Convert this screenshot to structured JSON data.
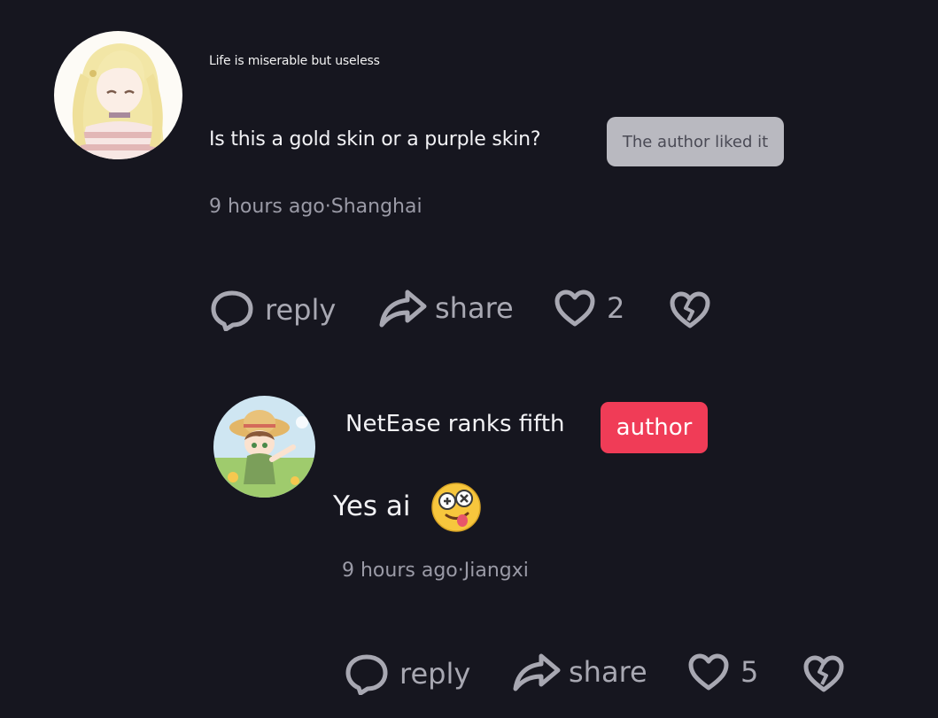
{
  "comment": {
    "username": "Life is miserable but useless",
    "text": "Is this a gold skin or a purple skin?",
    "liked_badge": "The author liked it",
    "time": "9 hours ago",
    "location": "Shanghai",
    "meta": "9 hours ago·Shanghai",
    "actions": {
      "reply": "reply",
      "share": "share",
      "likes": "2"
    },
    "icons": [
      "speech-bubble-icon",
      "share-arrow-icon",
      "heart-icon",
      "broken-heart-icon"
    ]
  },
  "reply": {
    "username": "NetEase ranks fifth",
    "badge": "author",
    "text": "Yes ai",
    "emoji": "dizzy-tongue-emoji",
    "meta": "9 hours ago·Jiangxi",
    "actions": {
      "reply": "reply",
      "share": "share",
      "likes": "5"
    }
  },
  "colors": {
    "background": "#16161f",
    "author_badge": "#f03c57",
    "liked_badge": "#b9b9c0",
    "muted_text": "#9a9aa6"
  }
}
